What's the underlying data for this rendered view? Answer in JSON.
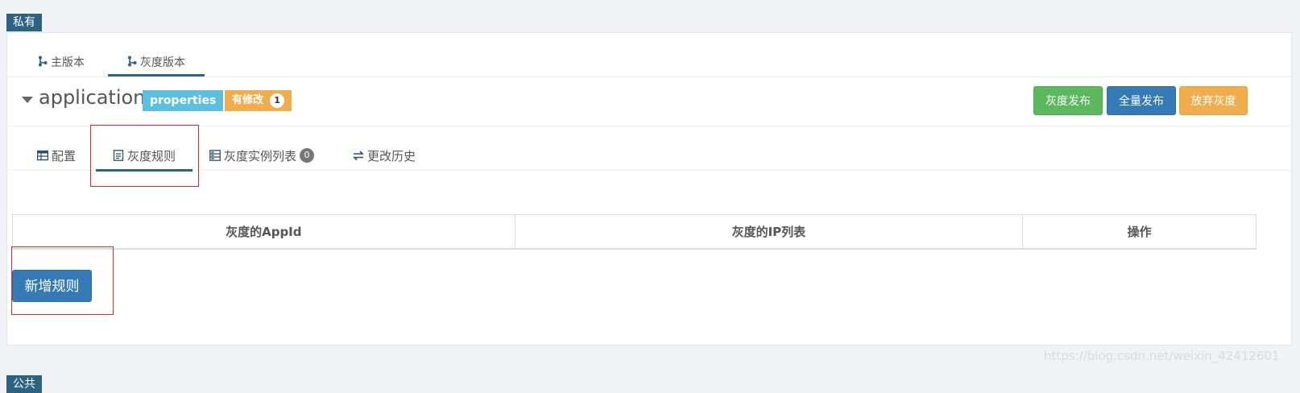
{
  "sections": {
    "private_label": "私有",
    "public_label": "公共"
  },
  "version_tabs": [
    {
      "label": "主版本",
      "icon": "branch-icon",
      "active": false
    },
    {
      "label": "灰度版本",
      "icon": "branch-icon",
      "active": true
    }
  ],
  "namespace": {
    "name": "application",
    "format_badge": "properties",
    "modified_badge": "有修改",
    "modified_count": "1"
  },
  "actions": {
    "gray_release": "灰度发布",
    "full_release": "全量发布",
    "abandon_gray": "放弃灰度"
  },
  "sub_tabs": [
    {
      "label": "配置",
      "icon": "table-icon",
      "active": false
    },
    {
      "label": "灰度规则",
      "icon": "document-icon",
      "active": true
    },
    {
      "label": "灰度实例列表",
      "icon": "server-list-icon",
      "active": false,
      "count": "0"
    },
    {
      "label": "更改历史",
      "icon": "exchange-icon",
      "active": false
    }
  ],
  "rules_table": {
    "headers": [
      "灰度的AppId",
      "灰度的IP列表",
      "操作"
    ]
  },
  "add_rule_label": "新增规则",
  "watermark": "https://blog.csdn.net/weixin_42412601",
  "colors": {
    "section_label_bg": "#2b6382",
    "success": "#5cb85c",
    "primary": "#337ab7",
    "warning": "#f0ad4e",
    "info": "#5bc0de",
    "highlight": "#e0282b"
  }
}
